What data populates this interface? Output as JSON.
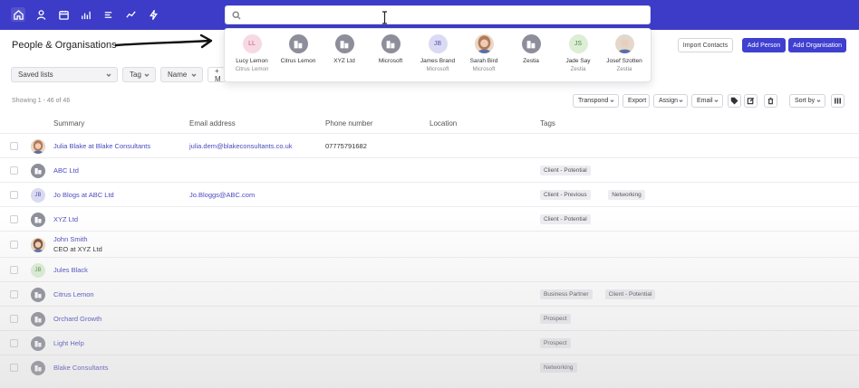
{
  "nav": {
    "items": [
      {
        "icon": "home-icon"
      },
      {
        "icon": "person-icon"
      },
      {
        "icon": "calendar-icon"
      },
      {
        "icon": "bar-chart-icon"
      },
      {
        "icon": "list-icon"
      },
      {
        "icon": "trend-line-icon"
      },
      {
        "icon": "lightning-icon"
      }
    ],
    "search": {
      "value": "",
      "placeholder": ""
    }
  },
  "page": {
    "title": "People & Organisations",
    "buttons": {
      "import": "Import Contacts",
      "add_person": "Add Person",
      "add_org": "Add Organisation"
    },
    "filters": {
      "saved_lists": "Saved lists",
      "tag": "Tag",
      "name": "Name",
      "more": "+ M"
    },
    "showing": "Showing 1 - 46 of 46",
    "toolbar": {
      "transpond": "Transpond",
      "export": "Export",
      "assign": "Assign",
      "email": "Email",
      "sort": "Sort by"
    }
  },
  "search_results": [
    {
      "name": "Lucy Lemon",
      "sub": "Citrus Lemon",
      "initials": "LL",
      "kind": "initials",
      "bg": "#f7d9e3",
      "fg": "#c7537a"
    },
    {
      "name": "Citrus Lemon",
      "sub": "",
      "initials": "",
      "kind": "org"
    },
    {
      "name": "XYZ Ltd",
      "sub": "",
      "initials": "",
      "kind": "org"
    },
    {
      "name": "Microsoft",
      "sub": "",
      "initials": "",
      "kind": "org"
    },
    {
      "name": "James Brand",
      "sub": "Microsoft",
      "initials": "JB",
      "kind": "initials",
      "bg": "#dadaf3",
      "fg": "#5656b5"
    },
    {
      "name": "Sarah Bird",
      "sub": "Microsoft",
      "initials": "",
      "kind": "photo"
    },
    {
      "name": "Zestia",
      "sub": "",
      "initials": "",
      "kind": "org"
    },
    {
      "name": "Jade Say",
      "sub": "Zestia",
      "initials": "JS",
      "kind": "initials",
      "bg": "#dcefd6",
      "fg": "#4f8c42"
    },
    {
      "name": "Josef Szotten",
      "sub": "Zestia",
      "initials": "",
      "kind": "photo"
    }
  ],
  "table": {
    "columns": [
      "Summary",
      "Email address",
      "Phone number",
      "Location",
      "Tags"
    ],
    "rows": [
      {
        "summary": "Julia Blake at Blake Consultants",
        "summary2": "",
        "email": "julia.dem@blakeconsultants.co.uk",
        "phone": "07775791682",
        "location": "",
        "tags": [],
        "kind": "photo"
      },
      {
        "summary": "ABC Ltd",
        "summary2": "",
        "email": "",
        "phone": "",
        "location": "",
        "tags": [
          "Client - Potential"
        ],
        "kind": "org"
      },
      {
        "summary": "Jo Blogs at ABC Ltd",
        "summary2": "",
        "email": "Jo.Bloggs@ABC.com",
        "phone": "",
        "location": "",
        "tags": [
          "Client - Previous",
          "Networking"
        ],
        "kind": "initials",
        "initials": "JB",
        "bg": "#dadaf3",
        "fg": "#5656b5"
      },
      {
        "summary": "XYZ Ltd",
        "summary2": "",
        "email": "",
        "phone": "",
        "location": "",
        "tags": [
          "Client - Potential"
        ],
        "kind": "org"
      },
      {
        "summary": "John Smith",
        "summary2": "CEO at XYZ Ltd",
        "email": "",
        "phone": "",
        "location": "",
        "tags": [],
        "kind": "photo"
      },
      {
        "summary": "Jules Black",
        "summary2": "",
        "email": "",
        "phone": "",
        "location": "",
        "tags": [],
        "kind": "initials",
        "initials": "JB",
        "bg": "#dcefd6",
        "fg": "#4f8c42"
      },
      {
        "summary": "Citrus Lemon",
        "summary2": "",
        "email": "",
        "phone": "",
        "location": "",
        "tags": [
          "Business Partner",
          "Client - Potential"
        ],
        "kind": "org"
      },
      {
        "summary": "Orchard Growth",
        "summary2": "",
        "email": "",
        "phone": "",
        "location": "",
        "tags": [
          "Prospect"
        ],
        "kind": "org"
      },
      {
        "summary": "Light Help",
        "summary2": "",
        "email": "",
        "phone": "",
        "location": "",
        "tags": [
          "Prospect"
        ],
        "kind": "org"
      },
      {
        "summary": "Blake Consultants",
        "summary2": "",
        "email": "",
        "phone": "",
        "location": "",
        "tags": [
          "Networking"
        ],
        "kind": "org"
      }
    ]
  },
  "colors": {
    "nav": "#3c3cc8",
    "primary": "#3f3fd0",
    "link": "#4a4ac0"
  }
}
